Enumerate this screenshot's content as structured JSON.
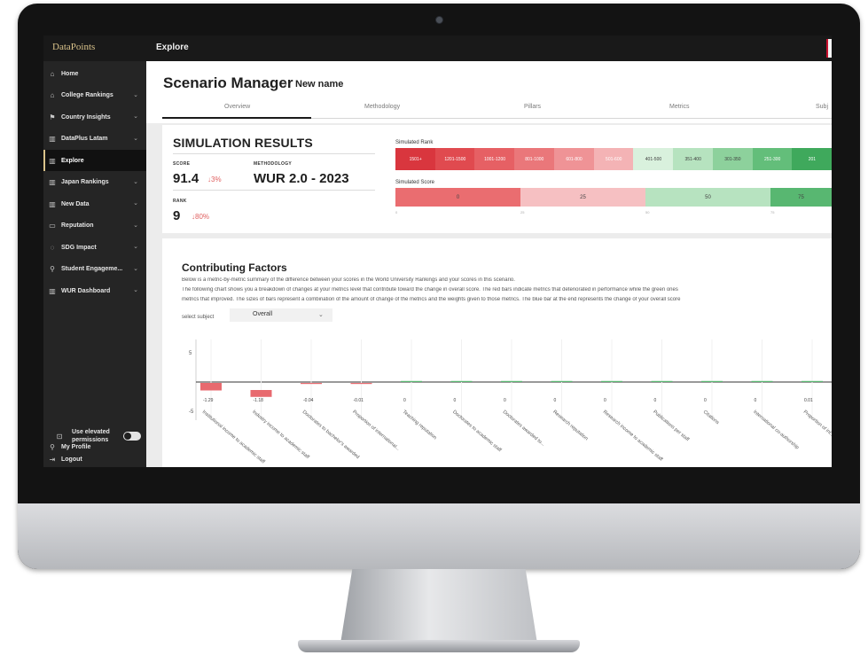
{
  "app": {
    "brand": "DataPoints",
    "topbar_title": "Explore"
  },
  "sidebar": {
    "items": [
      {
        "label": "Home",
        "icon": "home-icon",
        "glyph": "⌂",
        "chevron": false,
        "active": false
      },
      {
        "label": "College Rankings",
        "icon": "institution-icon",
        "glyph": "⌂",
        "chevron": true,
        "active": false
      },
      {
        "label": "Country Insights",
        "icon": "flag-icon",
        "glyph": "⚑",
        "chevron": true,
        "active": false
      },
      {
        "label": "DataPlus Latam",
        "icon": "bar-chart-icon",
        "glyph": "▥",
        "chevron": true,
        "active": false
      },
      {
        "label": "Explore",
        "icon": "chart-icon",
        "glyph": "▥",
        "chevron": false,
        "active": true
      },
      {
        "label": "Japan Rankings",
        "icon": "bar-chart-icon",
        "glyph": "▥",
        "chevron": true,
        "active": false
      },
      {
        "label": "New Data",
        "icon": "bar-chart-icon",
        "glyph": "▥",
        "chevron": true,
        "active": false
      },
      {
        "label": "Reputation",
        "icon": "message-icon",
        "glyph": "▭",
        "chevron": true,
        "active": false
      },
      {
        "label": "SDG Impact",
        "icon": "sdg-icon",
        "glyph": "◌",
        "chevron": true,
        "active": false
      },
      {
        "label": "Student Engageme...",
        "icon": "student-icon",
        "glyph": "⚲",
        "chevron": true,
        "active": false
      },
      {
        "label": "WUR Dashboard",
        "icon": "bar-chart-icon",
        "glyph": "▥",
        "chevron": true,
        "active": false
      }
    ],
    "elevated_label": "Use elevated permissions",
    "my_profile": "My Profile",
    "logout": "Logout"
  },
  "header": {
    "title": "Scenario Manager",
    "separator": "›",
    "current": "New name",
    "tabs": [
      "Overview",
      "Methodology",
      "Pillars",
      "Metrics",
      "Subj"
    ]
  },
  "simulation": {
    "title": "SIMULATION RESULTS",
    "score_label": "SCORE",
    "score": "91.4",
    "score_delta": "↓3%",
    "methodology_label": "METHODOLOGY",
    "methodology": "WUR 2.0 - 2023",
    "rank_label": "RANK",
    "rank": "9",
    "rank_delta": "↓80%",
    "simulated_rank_label": "Simulated Rank",
    "rank_bands": [
      {
        "label": "1501+",
        "color": "#d9363e"
      },
      {
        "label": "1201-1500",
        "color": "#e04a4f"
      },
      {
        "label": "1001-1200",
        "color": "#e66064"
      },
      {
        "label": "801-1000",
        "color": "#ea777a"
      },
      {
        "label": "601-800",
        "color": "#ef9396"
      },
      {
        "label": "501-600",
        "color": "#f4b3b5"
      },
      {
        "label": "401-500",
        "color": "#d9f1dd"
      },
      {
        "label": "351-400",
        "color": "#b6e3bf"
      },
      {
        "label": "301-350",
        "color": "#8dd19c"
      },
      {
        "label": "251-300",
        "color": "#63be7a"
      },
      {
        "label": "201",
        "color": "#3fa95c"
      }
    ],
    "simulated_score_label": "Simulated Score",
    "score_bands": [
      {
        "label": "0",
        "color": "#ea6d70"
      },
      {
        "label": "25",
        "color": "#f6c0c2"
      },
      {
        "label": "50",
        "color": "#b7e3c0"
      },
      {
        "label": "75",
        "color": "#58b771"
      }
    ],
    "score_ticks": [
      "0",
      "25",
      "50",
      "75"
    ]
  },
  "factors": {
    "title": "Contributing Factors",
    "desc1": "Below is a metric-by-metric summary of the difference between your scores in the World University Rankings and your scores in this scenario.",
    "desc2": "The following chart shows you a breakdown of changes at your metrics level that contribute toward the change in overall score. The red bars indicate metrics that deteriorated in performance while the green ones",
    "desc3": "metrics that improved. The sizes of bars represent a combination of the amount of change of the metrics and the weights given to those metrics. The blue bar at the end represents the change of your overall score",
    "subject_label": "select subject",
    "subject_value": "Overall"
  },
  "chart_data": {
    "type": "bar",
    "categories": [
      "Institutional income to academic staff",
      "Industry income to academic staff",
      "Doctorates to bachelor's awarded",
      "Proportion of international...",
      "Teaching reputation",
      "Doctorates to academic staff",
      "Doctorates awarded to...",
      "Research reputation",
      "Research income to academic staff",
      "Publications per staff",
      "Citations",
      "International co-authorship",
      "Proportion of int..."
    ],
    "values": [
      -1.29,
      -1.18,
      -0.04,
      -0.01,
      0,
      0,
      0,
      0,
      0,
      0,
      0,
      0,
      0.01
    ],
    "value_labels": [
      "-1.29",
      "-1.18",
      "-0.04",
      "-0.01",
      "0",
      "0",
      "0",
      "0",
      "0",
      "0",
      "0",
      "0",
      "0.01"
    ],
    "yticks": [
      "5",
      "-5"
    ],
    "ylim": [
      -5,
      5
    ],
    "colors": {
      "negative": "#e86a6f",
      "positive": "#5cb874"
    }
  }
}
